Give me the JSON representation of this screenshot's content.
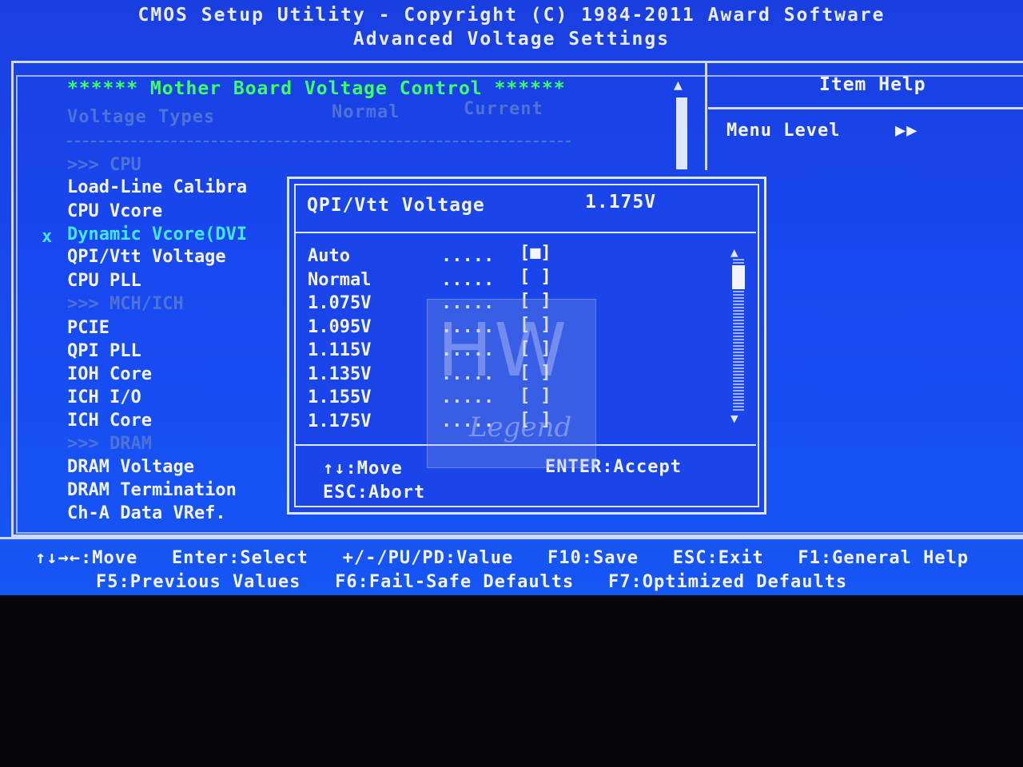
{
  "header": {
    "title_line": "CMOS Setup Utility - Copyright (C) 1984-2011 Award Software",
    "subtitle": "Advanced Voltage Settings"
  },
  "section": {
    "title": "****** Mother Board Voltage Control ******",
    "col_types": "Voltage Types",
    "col_normal": "Normal",
    "col_current": "Current"
  },
  "menu": {
    "cpu_group": ">>> CPU",
    "load_line": "Load-Line Calibra",
    "cpu_vcore": "CPU Vcore",
    "dynamic_mark": "x",
    "dynamic_vcore": "Dynamic Vcore(DVI",
    "qpi_vtt": "QPI/Vtt Voltage",
    "cpu_pll": "CPU PLL",
    "mch_group": ">>> MCH/ICH",
    "pcie": "PCIE",
    "qpi_pll": "QPI PLL",
    "ioh_core": "IOH Core",
    "ich_io": "ICH I/O",
    "ich_core": "ICH Core",
    "dram_group": ">>> DRAM",
    "dram_voltage": "DRAM Voltage",
    "dram_termination": "DRAM Termination",
    "cha_vref": "Ch-A Data VRef."
  },
  "item_help": {
    "title": "Item Help",
    "menu_level": "Menu Level",
    "menu_level_arrows": "▶▶"
  },
  "popup": {
    "title": "QPI/Vtt Voltage",
    "value": "1.175V",
    "options": [
      {
        "label": "Auto",
        "dots": ".....",
        "box": "[■]"
      },
      {
        "label": "Normal",
        "dots": ".....",
        "box": "[ ]"
      },
      {
        "label": "1.075V",
        "dots": ".....",
        "box": "[ ]"
      },
      {
        "label": "1.095V",
        "dots": ".....",
        "box": "[ ]"
      },
      {
        "label": "1.115V",
        "dots": ".....",
        "box": "[ ]"
      },
      {
        "label": "1.135V",
        "dots": ".....",
        "box": "[ ]"
      },
      {
        "label": "1.155V",
        "dots": ".....",
        "box": "[ ]"
      },
      {
        "label": "1.175V",
        "dots": ".....",
        "box": "[ ]"
      }
    ],
    "help_move": "↑↓:Move",
    "help_accept": "ENTER:Accept",
    "help_abort": "ESC:Abort"
  },
  "watermark": {
    "big": "HW",
    "small": "Legend"
  },
  "footer": {
    "line1": "↑↓→←:Move   Enter:Select   +/-/PU/PD:Value   F10:Save   ESC:Exit   F1:General Help",
    "line2": "F5:Previous Values   F6:Fail-Safe Defaults   F7:Optimized Defaults"
  }
}
